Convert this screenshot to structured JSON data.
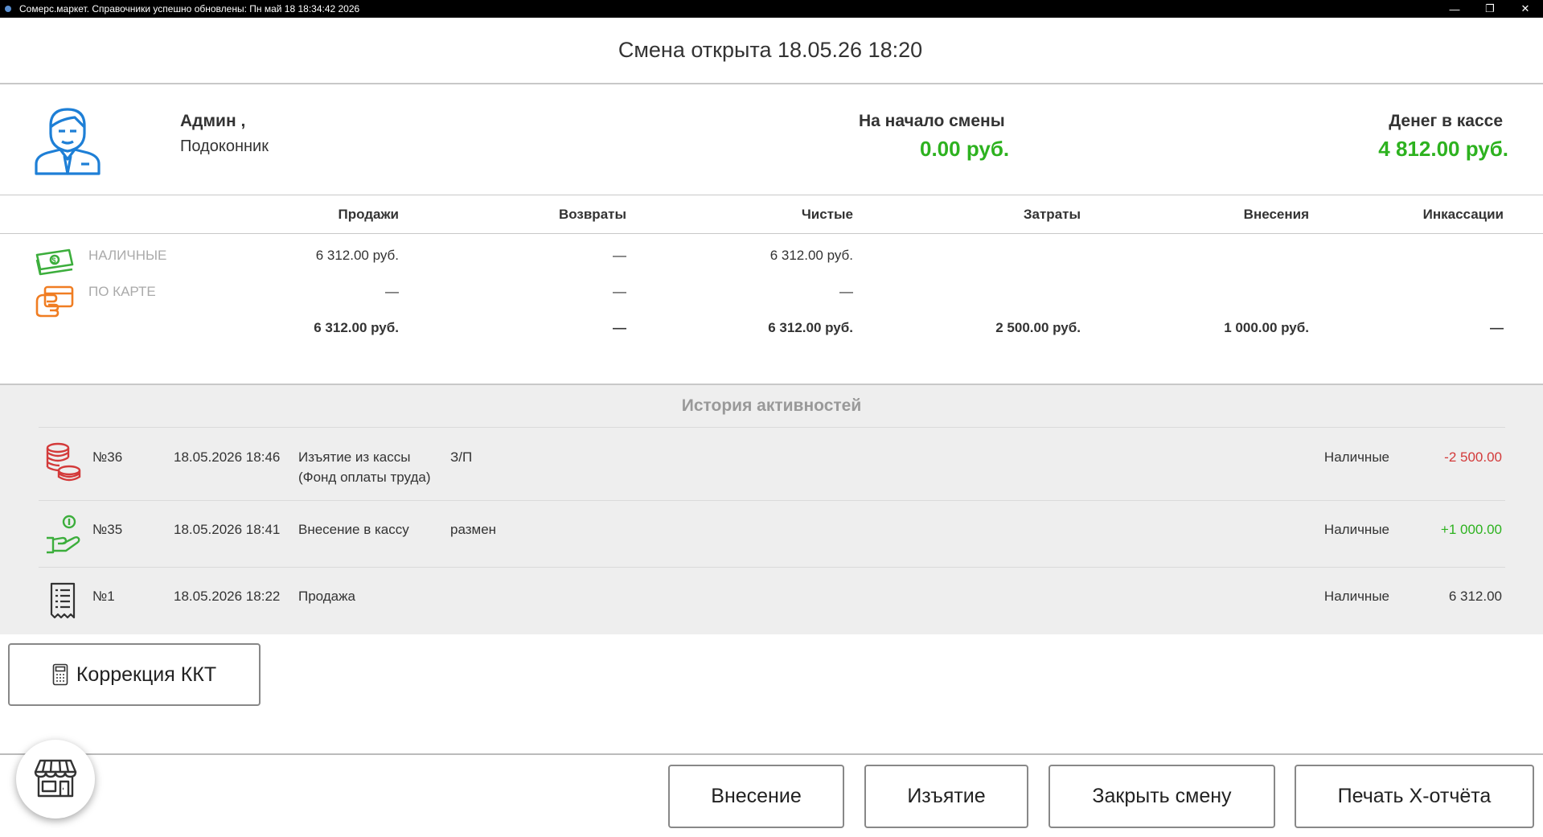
{
  "window": {
    "title": "Сомерс.маркет. Справочники успешно обновлены: Пн май 18 18:34:42 2026",
    "minimize_glyph": "—",
    "restore_glyph": "❐",
    "close_glyph": "✕"
  },
  "header": {
    "title": "Смена открыта 18.05.26 18:20"
  },
  "user": {
    "name": "Админ ,",
    "place": "Подоконник",
    "avatar_icon": "user-avatar-icon"
  },
  "summary": {
    "shift_start_label": "На начало смены",
    "shift_start_value": "0.00 руб.",
    "cash_label": "Денег в кассе",
    "cash_value": "4 812.00 руб."
  },
  "table": {
    "headers": [
      "Продажи",
      "Возвраты",
      "Чистые",
      "Затраты",
      "Внесения",
      "Инкассации"
    ],
    "rows": [
      {
        "label": "НАЛИЧНЫЕ",
        "icon": "cash-icon",
        "sales": "6 312.00 руб.",
        "returns": "—",
        "net": "6 312.00 руб."
      },
      {
        "label": "ПО КАРТЕ",
        "icon": "card-icon",
        "sales": "—",
        "returns": "—",
        "net": "—"
      }
    ],
    "totals": {
      "sales": "6 312.00 руб.",
      "returns": "—",
      "net": "6 312.00 руб.",
      "expenses": "2 500.00 руб.",
      "deposits": "1 000.00 руб.",
      "collections": "—"
    }
  },
  "history": {
    "title": "История активностей",
    "items": [
      {
        "icon": "coins-stack-icon",
        "num": "№36",
        "date": "18.05.2026 18:46",
        "type_line1": "Изъятие из кассы",
        "type_line2": "(Фонд оплаты труда)",
        "comment": "З/П",
        "method": "Наличные",
        "amount": "-2 500.00"
      },
      {
        "icon": "hand-coin-icon",
        "num": "№35",
        "date": "18.05.2026 18:41",
        "type_line1": "Внесение в кассу",
        "type_line2": "",
        "comment": "размен",
        "method": "Наличные",
        "amount": "+1 000.00"
      },
      {
        "icon": "receipt-icon",
        "num": "№1",
        "date": "18.05.2026 18:22",
        "type_line1": "Продажа",
        "type_line2": "",
        "comment": "",
        "method": "Наличные",
        "amount": "6 312.00"
      }
    ]
  },
  "colors": {
    "positive": "#2db21f",
    "negative": "#d33a3a",
    "avatar_blue": "#1e7fd6",
    "cash_green": "#3cae3c",
    "card_orange": "#f07d22"
  },
  "buttons": {
    "kkt_correction": "Коррекция ККТ",
    "deposit": "Внесение",
    "withdraw": "Изъятие",
    "close_shift": "Закрыть смену",
    "print_x": "Печать Х-отчёта"
  }
}
